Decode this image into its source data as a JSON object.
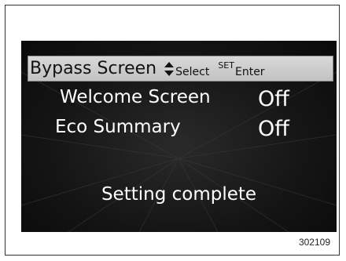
{
  "header": {
    "title": "Bypass Screen",
    "select_label": "Select",
    "set_label": "SET",
    "enter_label": "Enter"
  },
  "settings": [
    {
      "label": "Welcome Screen",
      "value": "Off"
    },
    {
      "label": "Eco Summary",
      "value": "Off"
    }
  ],
  "status_text": "Setting complete",
  "figure_id": "302109",
  "colors": {
    "screen_background": "#141414",
    "header_background": "#cccccc",
    "text": "#ffffff"
  }
}
